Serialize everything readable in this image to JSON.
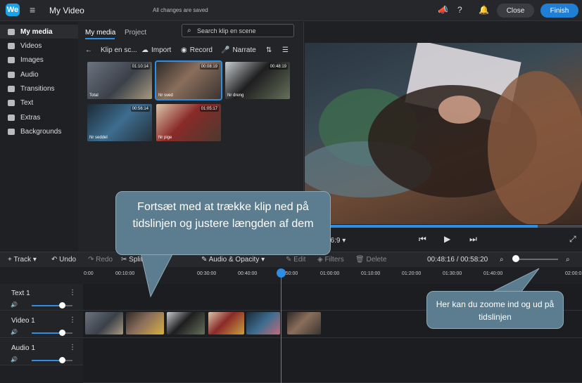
{
  "header": {
    "logo": "We",
    "title": "My Video",
    "status": "All changes are saved",
    "close_label": "Close",
    "finish_label": "Finish",
    "icons": [
      "menu-icon",
      "megaphone-icon",
      "help-icon",
      "bell-icon"
    ]
  },
  "sidebar": {
    "items": [
      {
        "label": "My media",
        "icon": "media-icon",
        "active": true
      },
      {
        "label": "Videos",
        "icon": "video-icon"
      },
      {
        "label": "Images",
        "icon": "image-icon"
      },
      {
        "label": "Audio",
        "icon": "music-icon"
      },
      {
        "label": "Transitions",
        "icon": "transitions-icon"
      },
      {
        "label": "Text",
        "icon": "text-icon"
      },
      {
        "label": "Extras",
        "icon": "extras-icon"
      },
      {
        "label": "Backgrounds",
        "icon": "backgrounds-icon"
      }
    ]
  },
  "media": {
    "tabs": [
      {
        "label": "My media"
      },
      {
        "label": "Project"
      }
    ],
    "search_placeholder": "Search klip en scene",
    "toolbar": {
      "folder_label": "Klip en sc...",
      "import_label": "Import",
      "record_label": "Record",
      "narrate_label": "Narrate"
    },
    "clips": [
      {
        "name": "Total",
        "duration": "01:10:14"
      },
      {
        "name": "Nr sved",
        "duration": "00:08:19"
      },
      {
        "name": "Nr dreng",
        "duration": "00:48:19"
      },
      {
        "name": "Nr seddel",
        "duration": "00:56:14"
      },
      {
        "name": "Nr pige",
        "duration": "01:05:17"
      }
    ]
  },
  "preview": {
    "aspect_label": "16:9",
    "progress": 0.84
  },
  "timeline": {
    "toolbar": {
      "track_label": "Track",
      "undo_label": "Undo",
      "redo_label": "Redo",
      "split_label": "Split",
      "audio_opacity_label": "Audio & Opacity",
      "edit_label": "Edit",
      "filters_label": "Filters",
      "delete_label": "Delete",
      "time": "00:48:16 / 00:58:20"
    },
    "ruler": [
      "0:00",
      "00:10:00",
      "00:30:00",
      "00:40:00",
      "00:50:00",
      "01:00:00",
      "01:10:00",
      "01:20:00",
      "01:30:00",
      "01:40:00",
      "02:00:0"
    ],
    "tracks": [
      {
        "name": "Text 1",
        "volume": 0.75
      },
      {
        "name": "Video 1",
        "volume": 0.75
      },
      {
        "name": "Audio 1",
        "volume": 0.75
      }
    ]
  },
  "callouts": {
    "drag_hint": "Fortsæt med at trække klip ned på tidslinjen og justere længden af dem",
    "zoom_hint": "Her kan du zoome ind og ud på tidslinjen"
  }
}
